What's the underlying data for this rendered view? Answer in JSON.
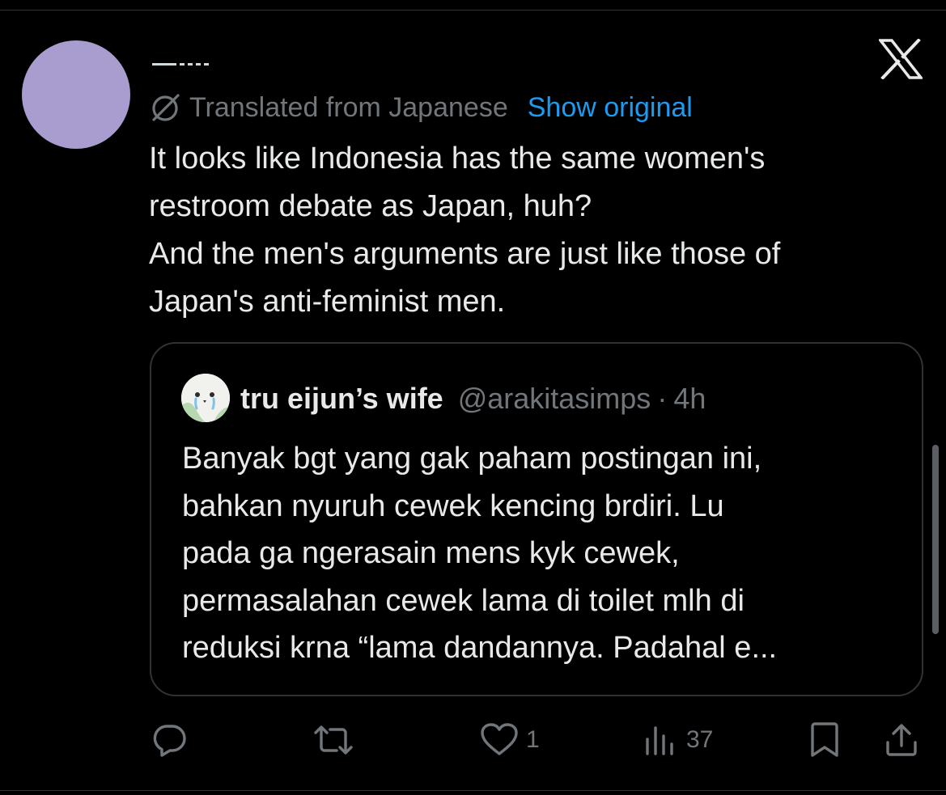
{
  "tweet": {
    "translated_label": "Translated from Japanese",
    "show_original_label": "Show original",
    "text": "It looks like Indonesia has the same women's\nrestroom debate as Japan, huh?\nAnd the men's arguments are just like those of\nJapan's anti-feminist men."
  },
  "quote": {
    "name": "tru eijun’s wife",
    "handle": "@arakitasimps",
    "separator": "·",
    "time": "4h",
    "text": "Banyak bgt yang gak paham postingan ini,\nbahkan nyuruh cewek kencing brdiri. Lu\npada ga ngerasain mens kyk cewek,\npermasalahan cewek lama di toilet mlh di\nreduksi krna “lama dandannya. Padahal e..."
  },
  "actions": {
    "reply_icon": "reply-icon",
    "retweet_icon": "retweet-icon",
    "like_icon": "heart-icon",
    "like_count": "1",
    "views_icon": "views-icon",
    "views_count": "37",
    "bookmark_icon": "bookmark-icon",
    "share_icon": "share-icon"
  },
  "colors": {
    "background": "#000000",
    "text": "#e7e9ea",
    "secondary": "#71767b",
    "link": "#1d9bf0",
    "border": "#2f3336",
    "avatar": "#a99cce"
  }
}
